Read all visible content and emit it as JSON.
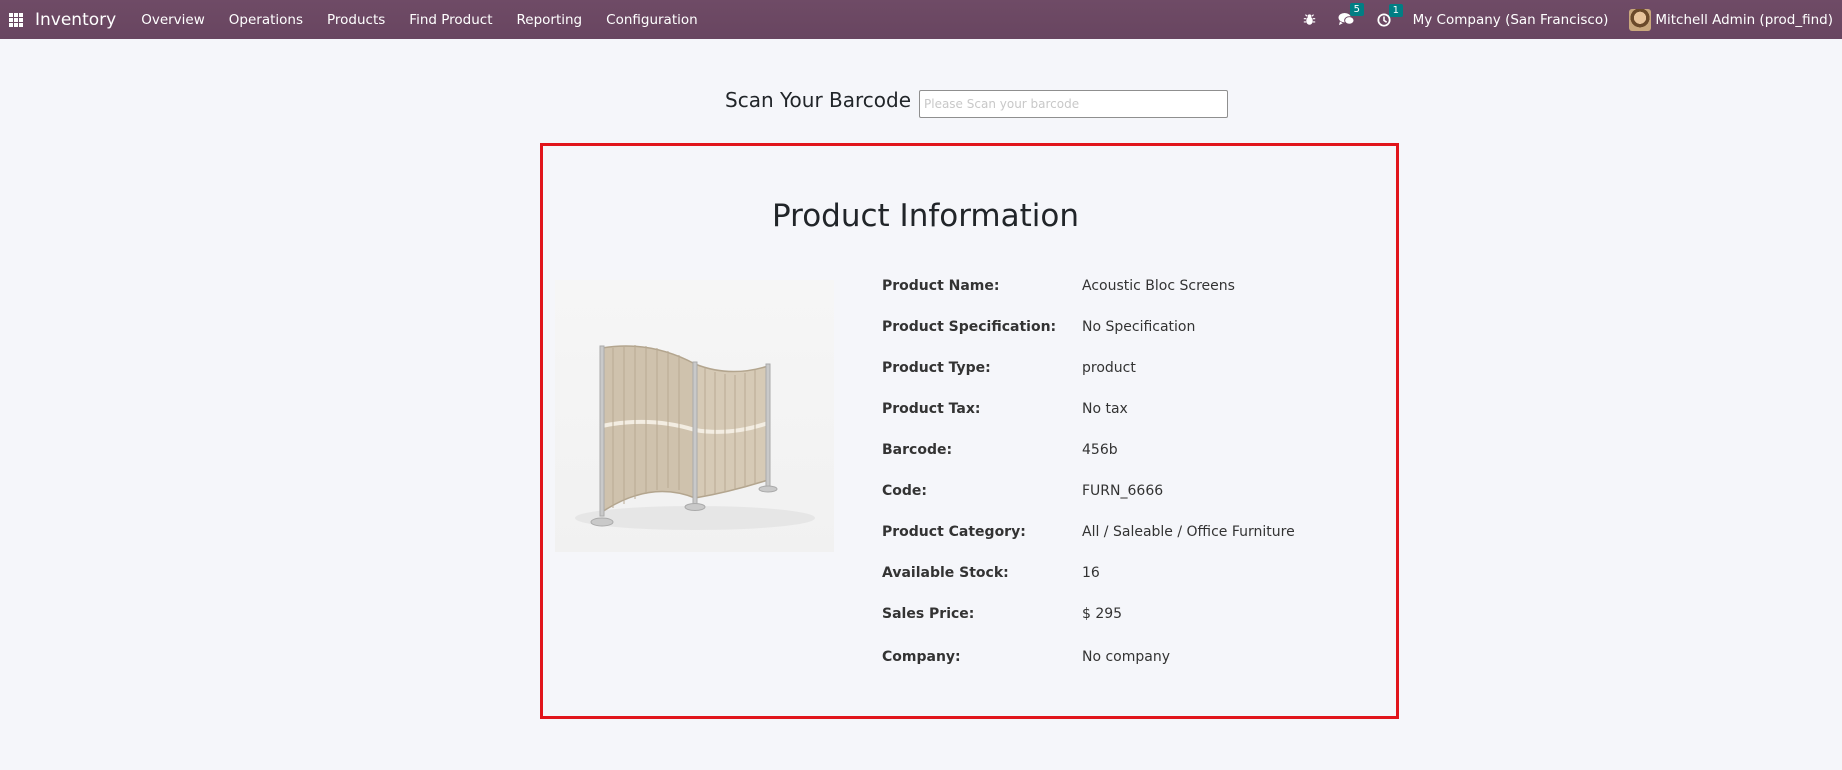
{
  "navbar": {
    "app_name": "Inventory",
    "menu": [
      "Overview",
      "Operations",
      "Products",
      "Find Product",
      "Reporting",
      "Configuration"
    ],
    "messages_count": "5",
    "activities_count": "1",
    "company": "My Company (San Francisco)",
    "user": "Mitchell Admin (prod_find)"
  },
  "scan": {
    "title": "Scan Your Barcode",
    "placeholder": "Please Scan your barcode"
  },
  "product": {
    "heading": "Product Information",
    "image_icon": "acoustic-screen-image",
    "fields": [
      {
        "label": "Product Name:",
        "value": "Acoustic Bloc Screens"
      },
      {
        "label": "Product Specification:",
        "value": "No Specification"
      },
      {
        "label": "Product Type:",
        "value": "product"
      },
      {
        "label": "Product Tax:",
        "value": "No tax"
      },
      {
        "label": "Barcode:",
        "value": "456b"
      },
      {
        "label": "Code:",
        "value": "FURN_6666"
      },
      {
        "label": "Product Category:",
        "value": "All / Saleable / Office Furniture"
      },
      {
        "label": "Available Stock:",
        "value": "16"
      },
      {
        "label": "Sales Price:",
        "value": "$ 295"
      },
      {
        "label": "Company:",
        "value": "No company"
      }
    ]
  },
  "colors": {
    "navbar": "#714b67",
    "highlight_border": "#e1141b",
    "badge": "#017e84"
  }
}
